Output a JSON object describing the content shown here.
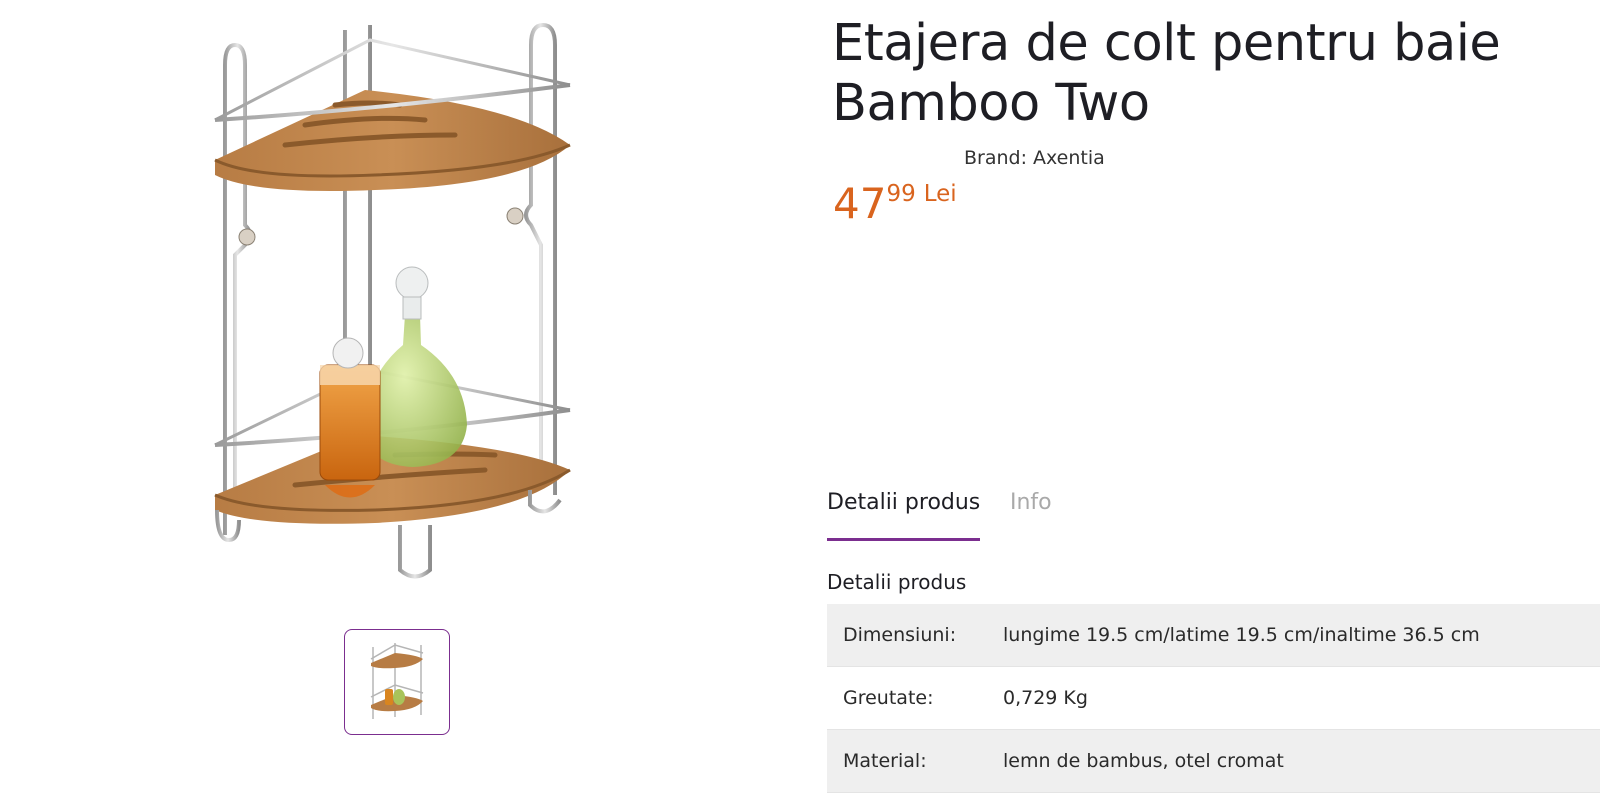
{
  "product": {
    "title": "Etajera de colt pentru baie Bamboo Two",
    "brand_label": "Brand:",
    "brand_name": "Axentia",
    "price_int": "47",
    "price_dec": "99",
    "currency": "Lei"
  },
  "gallery": {
    "main_image": "corner-shelf-product-photo",
    "thumbnails": [
      "corner-shelf-thumbnail"
    ]
  },
  "tabs": [
    {
      "label": "Detalii produs",
      "active": true
    },
    {
      "label": "Info",
      "active": false
    }
  ],
  "details": {
    "section_title": "Detalii produs",
    "rows": [
      {
        "key": "Dimensiuni:",
        "value": "lungime 19.5 cm/latime 19.5 cm/inaltime 36.5 cm"
      },
      {
        "key": "Greutate:",
        "value": "0,729 Kg"
      },
      {
        "key": "Material:",
        "value": "lemn de bambus, otel cromat"
      }
    ]
  },
  "colors": {
    "accent": "#7b2e8f",
    "price": "#d9641e",
    "row_shade": "#efefef"
  }
}
